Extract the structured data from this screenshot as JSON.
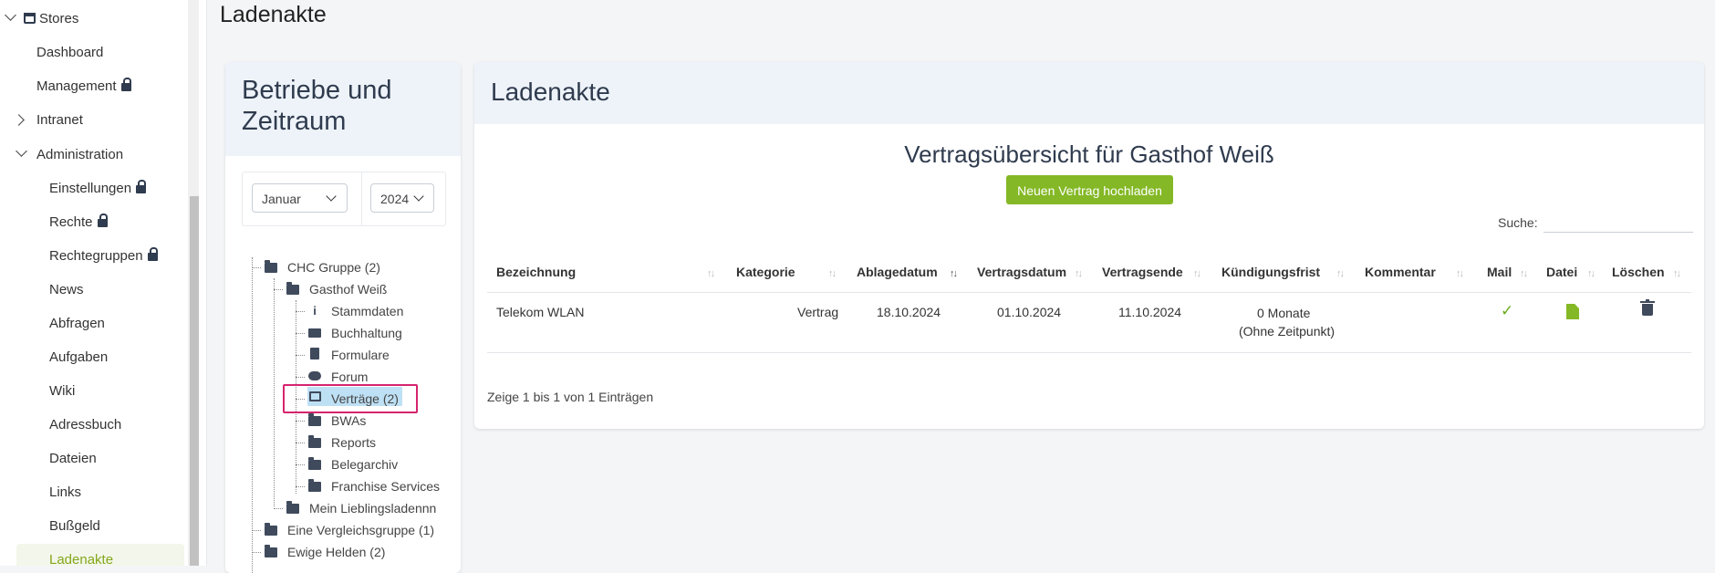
{
  "sidebar": {
    "stores_label": "Stores",
    "dashboard": "Dashboard",
    "management": "Management",
    "intranet": "Intranet",
    "administration": "Administration",
    "einstellungen": "Einstellungen",
    "rechte": "Rechte",
    "rechtegruppen": "Rechtegruppen",
    "news": "News",
    "abfragen": "Abfragen",
    "aufgaben": "Aufgaben",
    "wiki": "Wiki",
    "adressbuch": "Adressbuch",
    "dateien": "Dateien",
    "links": "Links",
    "bussgeld": "Bußgeld",
    "ladenakte": "Ladenakte"
  },
  "page_title": "Ladenakte",
  "left_panel": {
    "title": "Betriebe und Zeitraum",
    "month": "Januar",
    "year": "2024"
  },
  "tree": {
    "chc_gruppe": "CHC Gruppe (2)",
    "gasthof_weiss": "Gasthof Weiß",
    "stammdaten": "Stammdaten",
    "buchhaltung": "Buchhaltung",
    "formulare": "Formulare",
    "forum": "Forum",
    "vertraege": "Verträge (2)",
    "bwas": "BWAs",
    "reports": "Reports",
    "belegarchiv": "Belegarchiv",
    "franchise": "Franchise Services",
    "lieblingsladen": "Mein Lieblingsladennn",
    "vergleichsgruppe": "Eine Vergleichsgruppe (1)",
    "ewige_helden": "Ewige Helden (2)"
  },
  "right_panel": {
    "title": "Ladenakte",
    "contract_overview": "Vertragsübersicht für Gasthof Weiß",
    "upload_button": "Neuen Vertrag hochladen",
    "search_label": "Suche:"
  },
  "table": {
    "headers": {
      "bezeichnung": "Bezeichnung",
      "kategorie": "Kategorie",
      "ablagedatum": "Ablagedatum",
      "vertragsdatum": "Vertragsdatum",
      "vertragsende": "Vertragsende",
      "kuendigungsfrist": "Kündigungsfrist",
      "kommentar": "Kommentar",
      "mail": "Mail",
      "datei": "Datei",
      "loeschen": "Löschen"
    },
    "rows": [
      {
        "bezeichnung": "Telekom WLAN",
        "kategorie": "Vertrag",
        "ablagedatum": "18.10.2024",
        "vertragsdatum": "01.10.2024",
        "vertragsende": "11.10.2024",
        "kuendigungsfrist": "0 Monate",
        "kuendigungsfrist_note": "(Ohne Zeitpunkt)",
        "kommentar": ""
      }
    ],
    "info": "Zeige 1 bis 1 von 1 Einträgen"
  },
  "icons": {
    "mail": "check-icon",
    "datei": "pdf-icon",
    "loeschen": "trash-icon",
    "check_glyph": "✓",
    "stammdaten_glyph": "i",
    "sort_glyph": "↑↓"
  },
  "colors": {
    "accent": "#84b826",
    "highlight": "#d6246e",
    "selected": "#bee0f4",
    "header_bg": "#eef3f9"
  }
}
